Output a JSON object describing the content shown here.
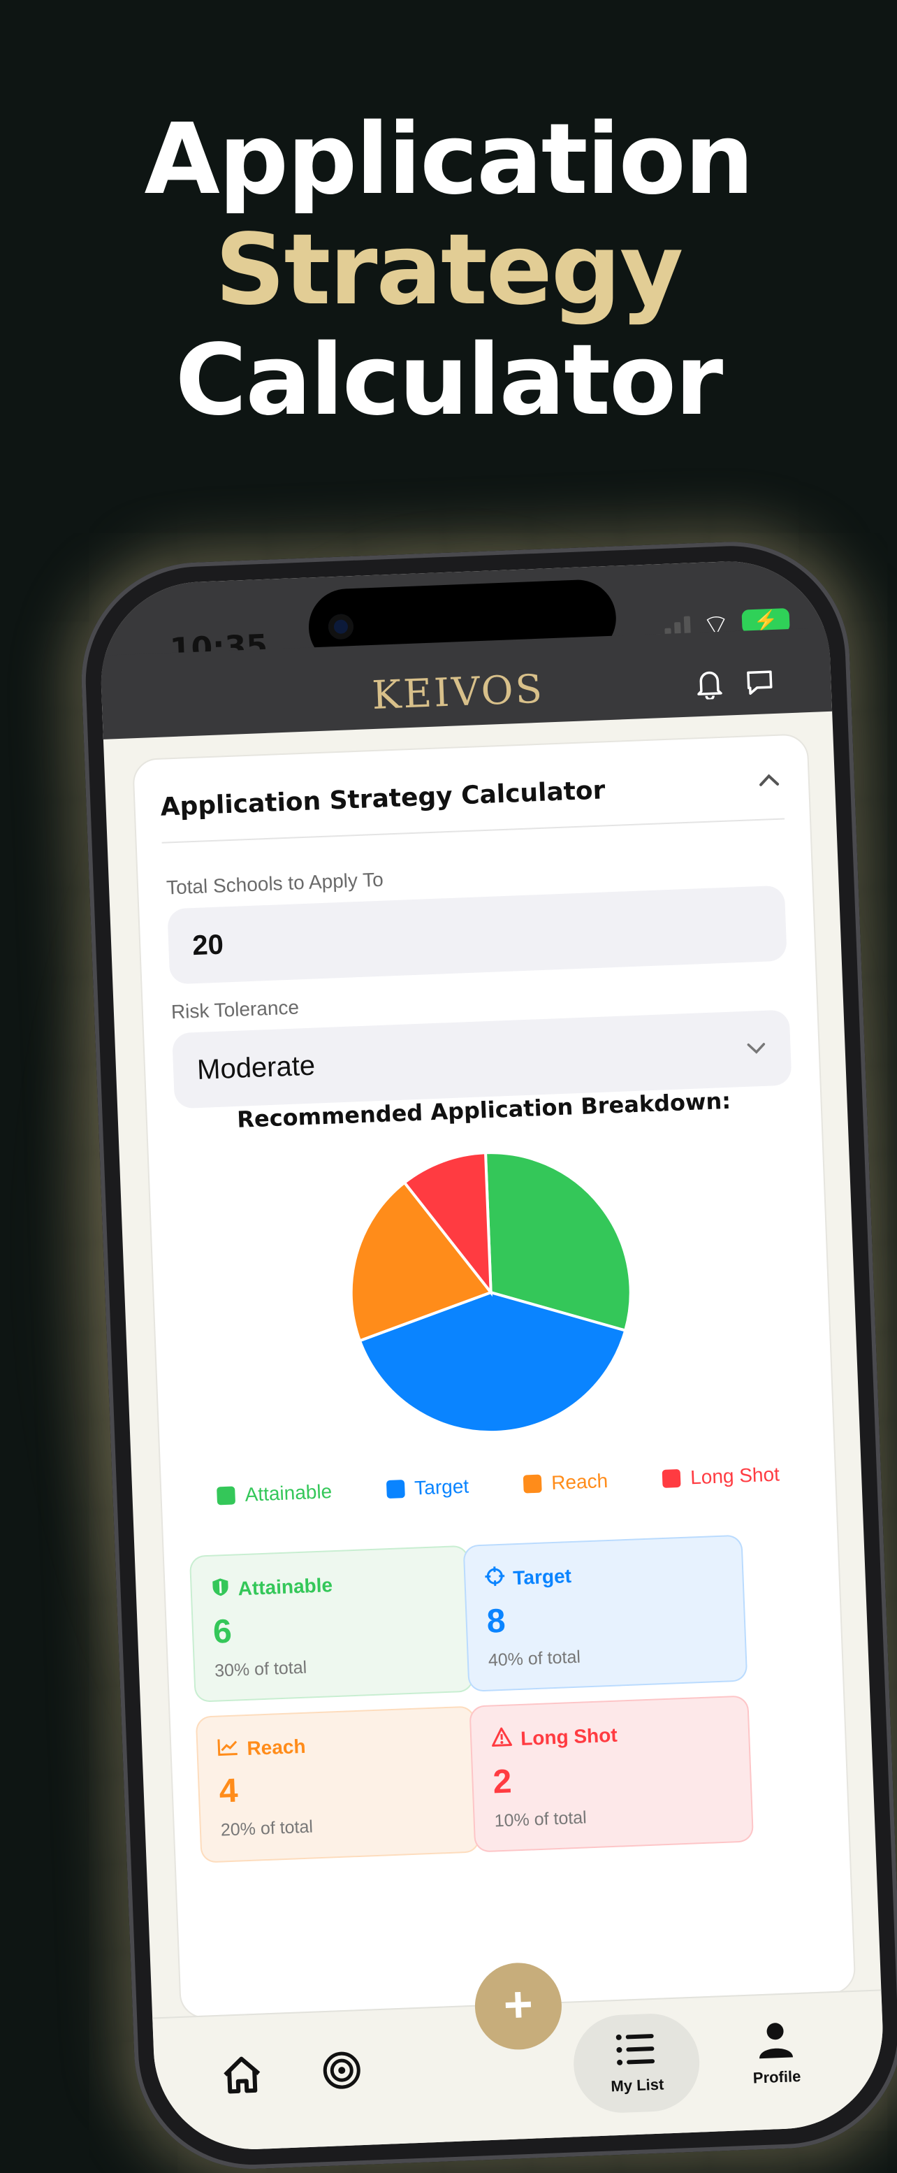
{
  "headline": {
    "line1": "Application",
    "line2": "Strategy",
    "line3": "Calculator"
  },
  "status": {
    "time": "10:35"
  },
  "app": {
    "logo": "KEIVOS"
  },
  "calculator": {
    "title": "Application Strategy Calculator",
    "total_label": "Total Schools to Apply To",
    "total_value": "20",
    "risk_label": "Risk Tolerance",
    "risk_value": "Moderate",
    "breakdown_title": "Recommended Application Breakdown:"
  },
  "chart_data": {
    "type": "pie",
    "categories": [
      "Attainable",
      "Target",
      "Reach",
      "Long Shot"
    ],
    "values": [
      6,
      8,
      4,
      2
    ],
    "colors": [
      "#34c759",
      "#0a84ff",
      "#ff8c1a",
      "#ff3b41"
    ],
    "title": "Recommended Application Breakdown:",
    "legend": "bottom"
  },
  "legend": [
    {
      "label": "Attainable",
      "color": "#34c759"
    },
    {
      "label": "Target",
      "color": "#0a84ff"
    },
    {
      "label": "Reach",
      "color": "#ff8c1a"
    },
    {
      "label": "Long Shot",
      "color": "#ff3b41"
    }
  ],
  "stats": [
    {
      "title": "Attainable",
      "count": "6",
      "sub": "30% of total",
      "color": "#34c759",
      "bg": "#eef8ef",
      "icon": "shield-icon"
    },
    {
      "title": "Target",
      "count": "8",
      "sub": "40% of total",
      "color": "#0a84ff",
      "bg": "#e7f2fe",
      "icon": "crosshair-icon"
    },
    {
      "title": "Reach",
      "count": "4",
      "sub": "20% of total",
      "color": "#ff8c1a",
      "bg": "#fdf1e6",
      "icon": "trend-up-icon"
    },
    {
      "title": "Long Shot",
      "count": "2",
      "sub": "10% of total",
      "color": "#ff3b41",
      "bg": "#fde8e9",
      "icon": "warning-icon"
    }
  ],
  "tabs": {
    "home_icon": "home-icon",
    "target_icon": "target-icon",
    "add_icon": "plus-icon",
    "mylist_label": "My List",
    "profile_label": "Profile"
  }
}
